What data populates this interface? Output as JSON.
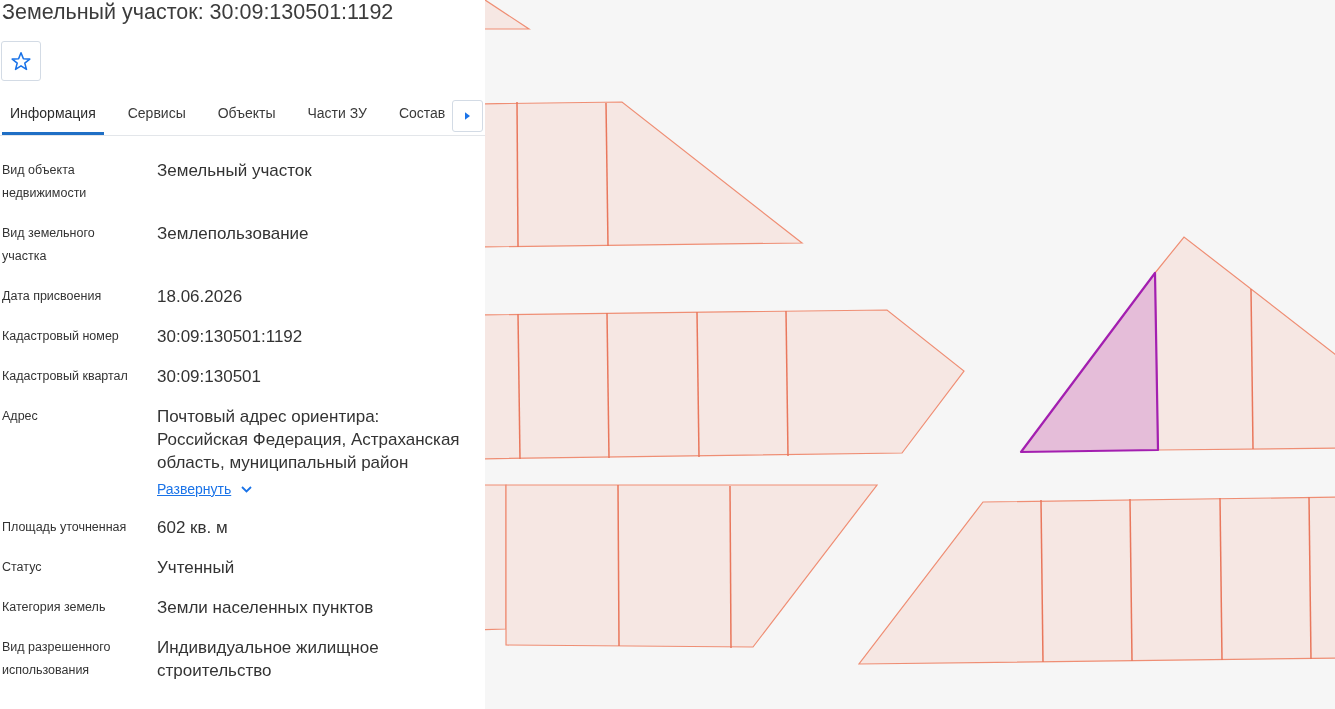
{
  "title": "Земельный участок: 30:09:130501:1192",
  "favorite": {
    "on": false
  },
  "tabs": [
    {
      "label": "Информация",
      "selected": true
    },
    {
      "label": "Сервисы",
      "selected": false
    },
    {
      "label": "Объекты",
      "selected": false
    },
    {
      "label": "Части ЗУ",
      "selected": false
    },
    {
      "label": "Состав",
      "selected": false
    }
  ],
  "properties": [
    {
      "label": "Вид объекта недвижимости",
      "value": "Земельный участок"
    },
    {
      "label": "Вид земельного участка",
      "value": "Землепользование"
    },
    {
      "label": "Дата присвоения",
      "value": "18.06.2026"
    },
    {
      "label": "Кадастровый номер",
      "value": "30:09:130501:1192"
    },
    {
      "label": "Кадастровый квартал",
      "value": "30:09:130501"
    },
    {
      "label": "Адрес",
      "value": "Почтовый адрес ориентира: Российская Федерация, Астраханская область, муниципальный район",
      "expand_link": "Развернуть"
    },
    {
      "label": "Площадь уточненная",
      "value": "602 кв. м"
    },
    {
      "label": "Статус",
      "value": "Учтенный"
    },
    {
      "label": "Категория земель",
      "value": "Земли населенных пунктов"
    },
    {
      "label": "Вид разрешенного использования",
      "value": "Индивидуальное жилищное строительство"
    }
  ]
}
